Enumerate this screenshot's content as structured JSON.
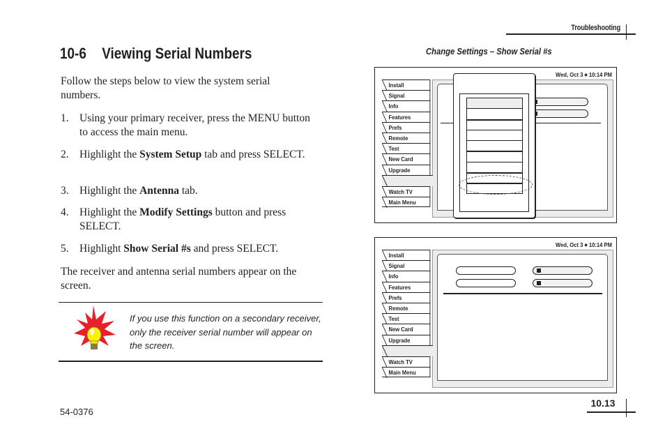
{
  "header": {
    "section": "Troubleshooting"
  },
  "title": {
    "number": "10-6",
    "text": "Viewing Serial Numbers"
  },
  "intro": "Follow the steps below to view the system serial numbers.",
  "steps": [
    {
      "n": "1.",
      "pre": "Using your primary receiver, press the MENU button to access the main menu.",
      "bold": "",
      "post": ""
    },
    {
      "n": "2.",
      "pre": "Highlight the ",
      "bold": "System Setup",
      "post": " tab and press SELECT."
    },
    {
      "n": "3.",
      "pre": "Highlight the ",
      "bold": "Antenna",
      "post": " tab."
    },
    {
      "n": "4.",
      "pre": "Highlight the ",
      "bold": "Modify Settings",
      "post": " button and press SELECT."
    },
    {
      "n": "5.",
      "pre": "Highlight ",
      "bold": "Show Serial #s",
      "post": " and press SELECT."
    }
  ],
  "outro": "The receiver and antenna serial numbers appear on the screen.",
  "tip": {
    "icon": "lightbulb-burst-icon",
    "text": "If you use this function on a secondary receiver, only the receiver serial number will appear on the screen.",
    "colors": {
      "burst": "#e8202a",
      "bulb": "#fff200",
      "base": "#8c7a3a"
    }
  },
  "figure": {
    "caption": "Change Settings – Show Serial #s",
    "screens": [
      {
        "date": "Wed, Oct 3",
        "time": "10:14 PM",
        "tabs": [
          "Install",
          "Signal",
          "Info",
          "Features",
          "Prefs",
          "Remote",
          "Test",
          "New Card",
          "Upgrade"
        ],
        "bottom_tabs": [
          "Watch TV",
          "Main Menu"
        ],
        "popup": {
          "items_count": 9,
          "highlighted_index": 7
        }
      },
      {
        "date": "Wed, Oct 3",
        "time": "10:14 PM",
        "tabs": [
          "Install",
          "Signal",
          "Info",
          "Features",
          "Prefs",
          "Remote",
          "Test",
          "New Card",
          "Upgrade"
        ],
        "bottom_tabs": [
          "Watch TV",
          "Main Menu"
        ]
      }
    ]
  },
  "footer": {
    "doc_number": "54-0376",
    "page_number": "10.13"
  }
}
